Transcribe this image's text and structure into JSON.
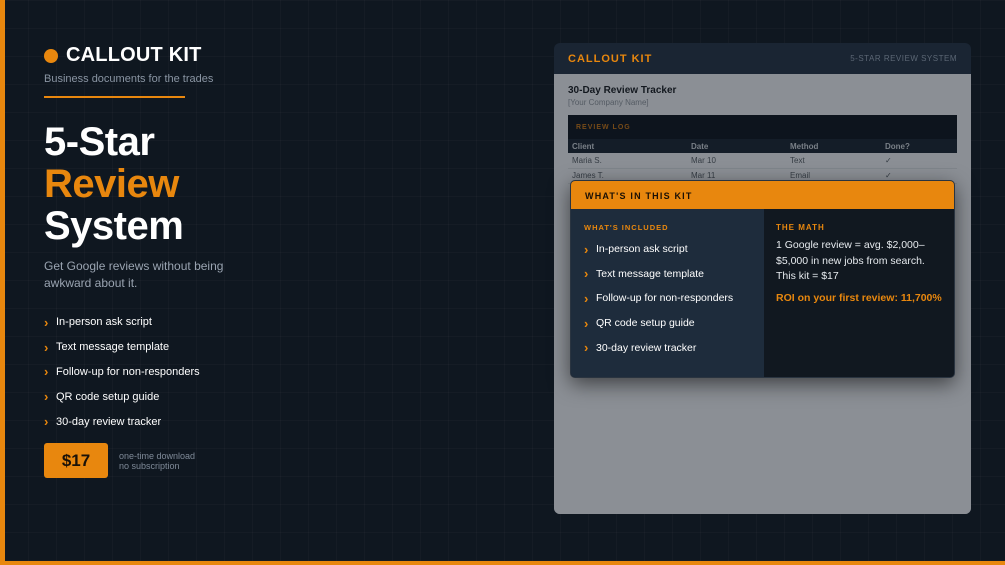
{
  "brand": {
    "name": "CALLOUT KIT",
    "tagline": "Business documents for the trades"
  },
  "headline": {
    "line1": "5-Star",
    "line2": "Review",
    "line3": "System"
  },
  "subline": "Get Google reviews without being awkward about it.",
  "features": [
    "In-person ask script",
    "Text message template",
    "Follow-up for non-responders",
    "QR code setup guide",
    "30-day review tracker"
  ],
  "price": {
    "label": "$17",
    "note1": "one-time download",
    "note2": "no subscription"
  },
  "doc": {
    "brand": "CALLOUT KIT",
    "subtitle": "5-STAR REVIEW SYSTEM",
    "title": "30-Day Review Tracker",
    "company": "[Your Company Name]",
    "log_title": "REVIEW LOG",
    "columns": [
      "Client",
      "Date",
      "Method",
      "Done?"
    ],
    "rows": [
      [
        "Maria S.",
        "Mar 10",
        "Text",
        "✓"
      ],
      [
        "James T.",
        "Mar 11",
        "Email",
        "✓"
      ]
    ]
  },
  "kit": {
    "header": "WHAT'S IN THIS KIT",
    "included_label": "WHAT'S INCLUDED",
    "items": [
      "In-person ask script",
      "Text message template",
      "Follow-up for non-responders",
      "QR code setup guide",
      "30-day review tracker"
    ],
    "math_label": "THE MATH",
    "math_text": "1 Google review = avg. $2,000–$5,000 in new jobs from search.",
    "math_price": "This kit = $17",
    "roi": "ROI on your first review: 11,700%"
  },
  "colors": {
    "accent": "#e8870e",
    "background": "#0f1720",
    "panel": "#1e2c3c"
  },
  "icons": {
    "bullet": "chevron-right-icon",
    "brand": "dot-icon"
  }
}
